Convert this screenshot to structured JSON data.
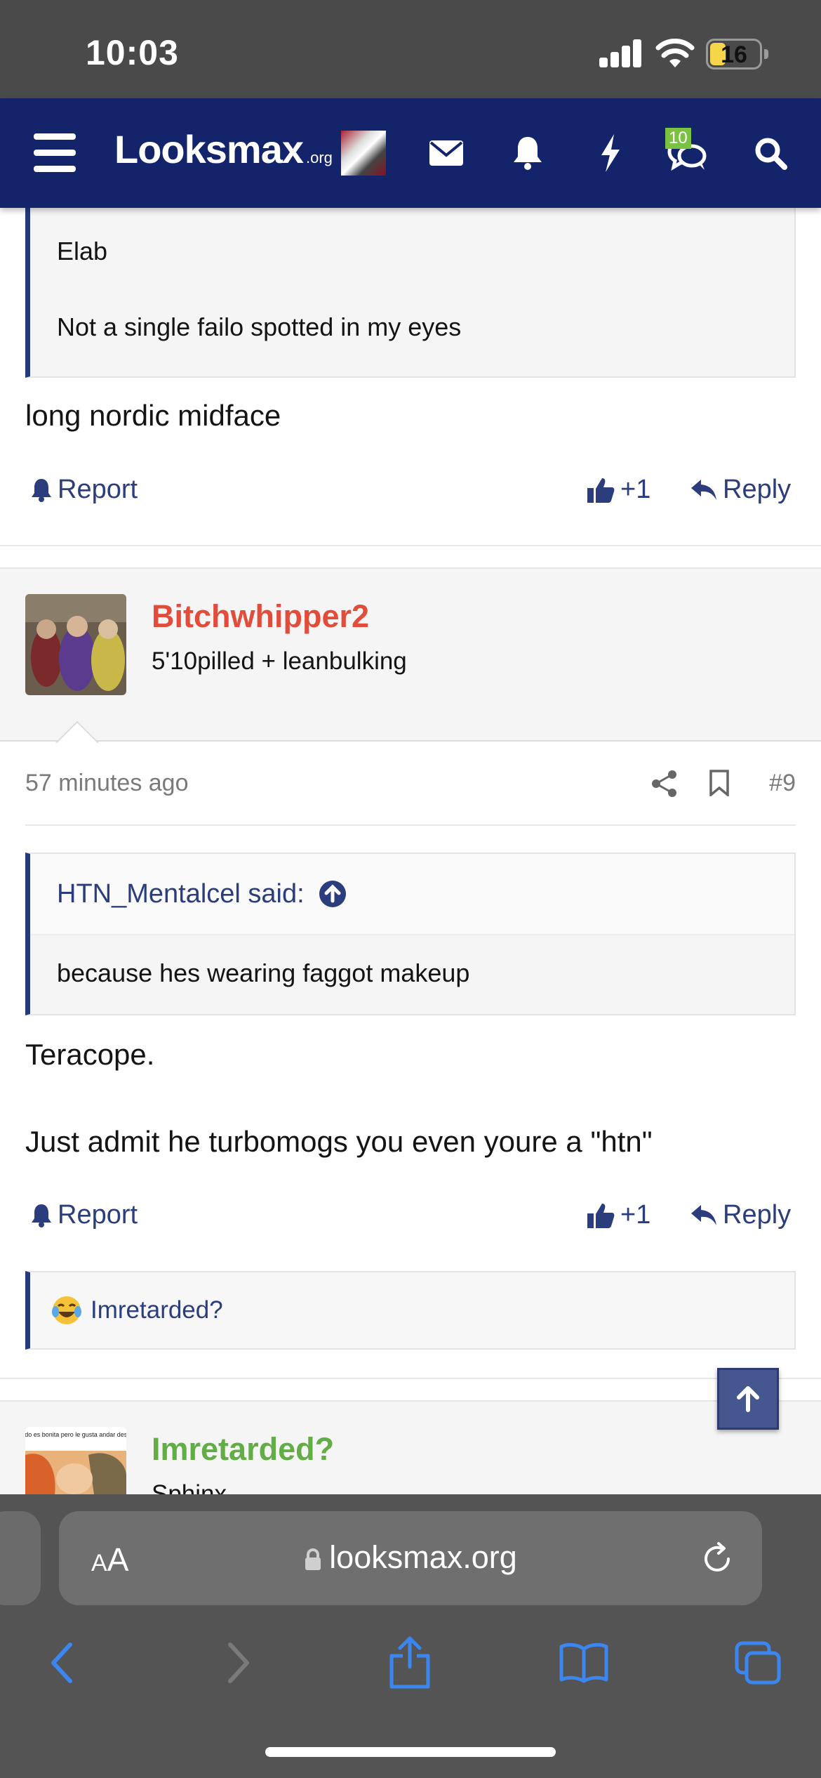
{
  "status_bar": {
    "time": "10:03",
    "battery": "16"
  },
  "nav": {
    "logo": "Looksmax",
    "logo_tld": ".org",
    "notifications_badge": "10"
  },
  "post1": {
    "quote_lines": [
      "Elab",
      "Not a single failo spotted in my eyes"
    ],
    "text": "long nordic midface",
    "report": "Report",
    "like": "+1",
    "reply": "Reply"
  },
  "post2": {
    "username": "Bitchwhipper2",
    "username_color": "#e24c3a",
    "user_title": "5'10pilled + leanbulking",
    "time": "57 minutes ago",
    "number": "#9",
    "quote_author": "HTN_Mentalcel said:",
    "quote_text": "because hes wearing faggot makeup",
    "text_lines": [
      "Teracope.",
      "Just admit he turbomogs you even youre a \"htn\""
    ],
    "report": "Report",
    "like": "+1",
    "reply": "Reply",
    "reaction_user": "Imretarded?"
  },
  "post3": {
    "username": "Imretarded?",
    "username_color": "#63ad46",
    "user_title_partial": "Sphinx",
    "avatar_caption": "Cuando es bonita pero le gusta andar descalza"
  },
  "safari": {
    "aa_label": "AA",
    "url": "looksmax.org"
  },
  "colors": {
    "nav_bg": "#14246b",
    "link": "#2b3d7c",
    "quote_border": "#263a7b"
  }
}
